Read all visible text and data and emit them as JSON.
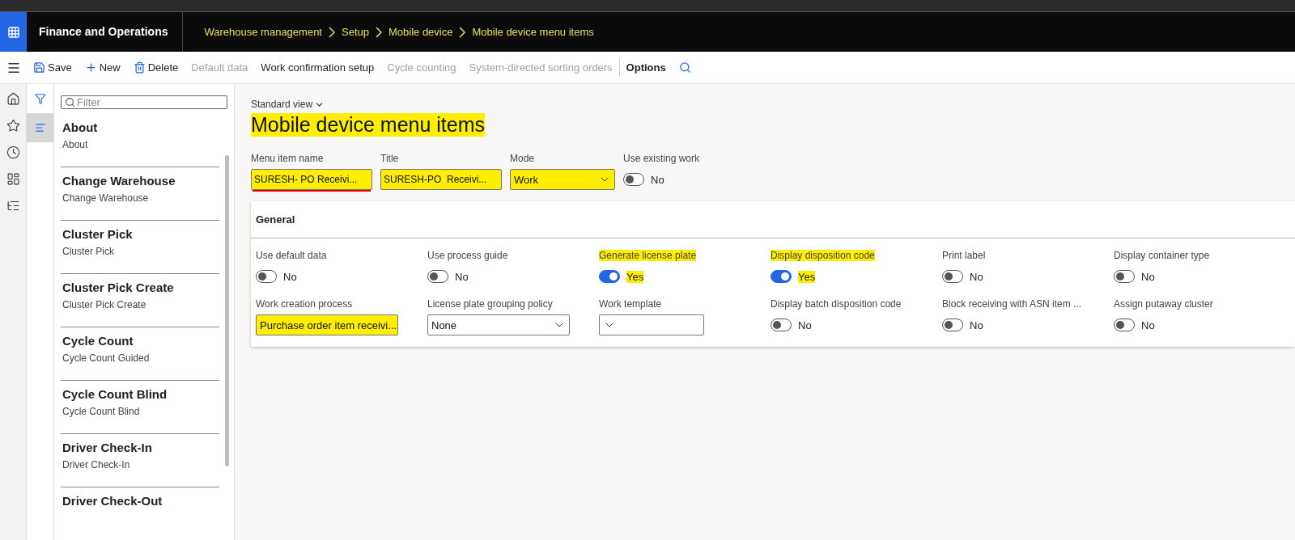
{
  "app": {
    "name": "Finance and Operations"
  },
  "breadcrumb": [
    "Warehouse management",
    "Setup",
    "Mobile device",
    "Mobile device menu items"
  ],
  "toolbar": [
    {
      "kind": "save",
      "label": "Save",
      "disabled": false
    },
    {
      "kind": "new",
      "label": "New",
      "disabled": false
    },
    {
      "kind": "delete",
      "label": "Delete",
      "disabled": false
    },
    {
      "kind": "text",
      "label": "Default data",
      "disabled": true
    },
    {
      "kind": "text",
      "label": "Work confirmation setup",
      "disabled": false
    },
    {
      "kind": "text",
      "label": "Cycle counting",
      "disabled": true
    },
    {
      "kind": "text",
      "label": "System-directed sorting orders",
      "disabled": true
    },
    {
      "kind": "options",
      "label": "Options",
      "disabled": false
    }
  ],
  "list": {
    "filter": {
      "placeholder": "Filter"
    },
    "items": [
      {
        "title": "About",
        "subtitle": "About",
        "selected": false
      },
      {
        "title": "Change Warehouse",
        "subtitle": "Change Warehouse",
        "selected": false
      },
      {
        "title": "Cluster Pick",
        "subtitle": "Cluster Pick",
        "selected": false
      },
      {
        "title": "Cluster Pick Create",
        "subtitle": "Cluster Pick Create",
        "selected": false
      },
      {
        "title": "Cycle Count",
        "subtitle": "Cycle Count Guided",
        "selected": false
      },
      {
        "title": "Cycle Count Blind",
        "subtitle": "Cycle Count Blind",
        "selected": false
      },
      {
        "title": "Driver Check-In",
        "subtitle": "Driver Check-In",
        "selected": false
      },
      {
        "title": "Driver Check-Out",
        "selected": false
      }
    ]
  },
  "view": "Standard view",
  "title": "Mobile device menu items",
  "title_highlighted": true,
  "header_fields": [
    {
      "kind": "text",
      "label": "Menu item name",
      "value": "SURESH- PO Receivi...",
      "highlighted": true,
      "underlined": true
    },
    {
      "kind": "text",
      "label": "Title",
      "value": "SURESH-PO  Receivi...",
      "highlighted": true,
      "underlined": false
    },
    {
      "kind": "dropdown",
      "label": "Mode",
      "value": "Work",
      "highlighted": true
    },
    {
      "kind": "toggle",
      "label": "Use existing work",
      "on": false,
      "value": "No",
      "highlighted": false
    }
  ],
  "general": {
    "title": "General",
    "fields": [
      {
        "kind": "toggle",
        "label": "Use default data",
        "on": false,
        "value": "No",
        "highlighted": false
      },
      {
        "kind": "toggle",
        "label": "Use process guide",
        "on": false,
        "value": "No",
        "highlighted": false
      },
      {
        "kind": "toggle",
        "label": "Generate license plate",
        "on": true,
        "value": "Yes",
        "highlighted": true
      },
      {
        "kind": "toggle",
        "label": "Display disposition code",
        "on": true,
        "value": "Yes",
        "highlighted": true
      },
      {
        "kind": "toggle",
        "label": "Print label",
        "on": false,
        "value": "No",
        "highlighted": false
      },
      {
        "kind": "toggle",
        "label": "Display container type",
        "on": false,
        "value": "No",
        "highlighted": false
      },
      {
        "kind": "dropdown",
        "label": "Work creation process",
        "value": "Purchase order item receivi...",
        "highlighted": true
      },
      {
        "kind": "dropdown",
        "label": "License plate grouping policy",
        "value": "None",
        "highlighted": false
      },
      {
        "kind": "dropdown",
        "label": "Work template",
        "highlighted": false
      },
      {
        "kind": "toggle",
        "label": "Display batch disposition code",
        "on": false,
        "value": "No",
        "highlighted": false
      },
      {
        "kind": "toggle",
        "label": "Block receiving with ASN item ...",
        "on": false,
        "value": "No",
        "highlighted": false
      },
      {
        "kind": "toggle",
        "label": "Assign putaway cluster",
        "on": false,
        "value": "No",
        "highlighted": false
      }
    ]
  }
}
